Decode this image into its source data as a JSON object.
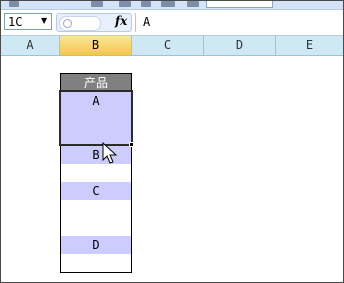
{
  "formula_bar": {
    "name_box": "1C",
    "fx_label": "fx",
    "content": "A"
  },
  "columns": [
    {
      "label": "A",
      "selected": false
    },
    {
      "label": "B",
      "selected": true
    },
    {
      "label": "C",
      "selected": false
    },
    {
      "label": "D",
      "selected": false
    },
    {
      "label": "E",
      "selected": false
    }
  ],
  "cells": {
    "header": "产品",
    "rows": [
      "A",
      "",
      "",
      "B",
      "",
      "C",
      "",
      "",
      "D",
      ""
    ]
  },
  "colors": {
    "filled_cell": "#ccccff",
    "header_cell": "#808080",
    "column_header_bg": "#cfe9f4",
    "selected_column_header": "#f7c64a"
  }
}
